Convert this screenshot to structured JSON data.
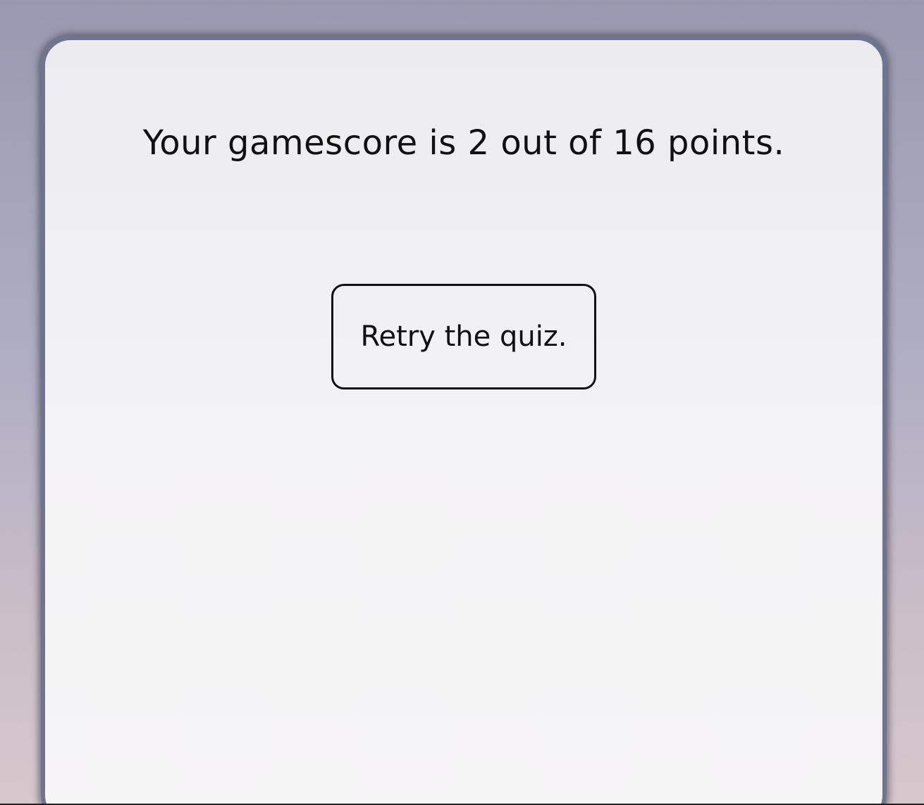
{
  "result": {
    "score_text": "Your gamescore is 2 out of 16 points.",
    "score": 2,
    "max_score": 16
  },
  "actions": {
    "retry_label": "Retry the quiz."
  }
}
